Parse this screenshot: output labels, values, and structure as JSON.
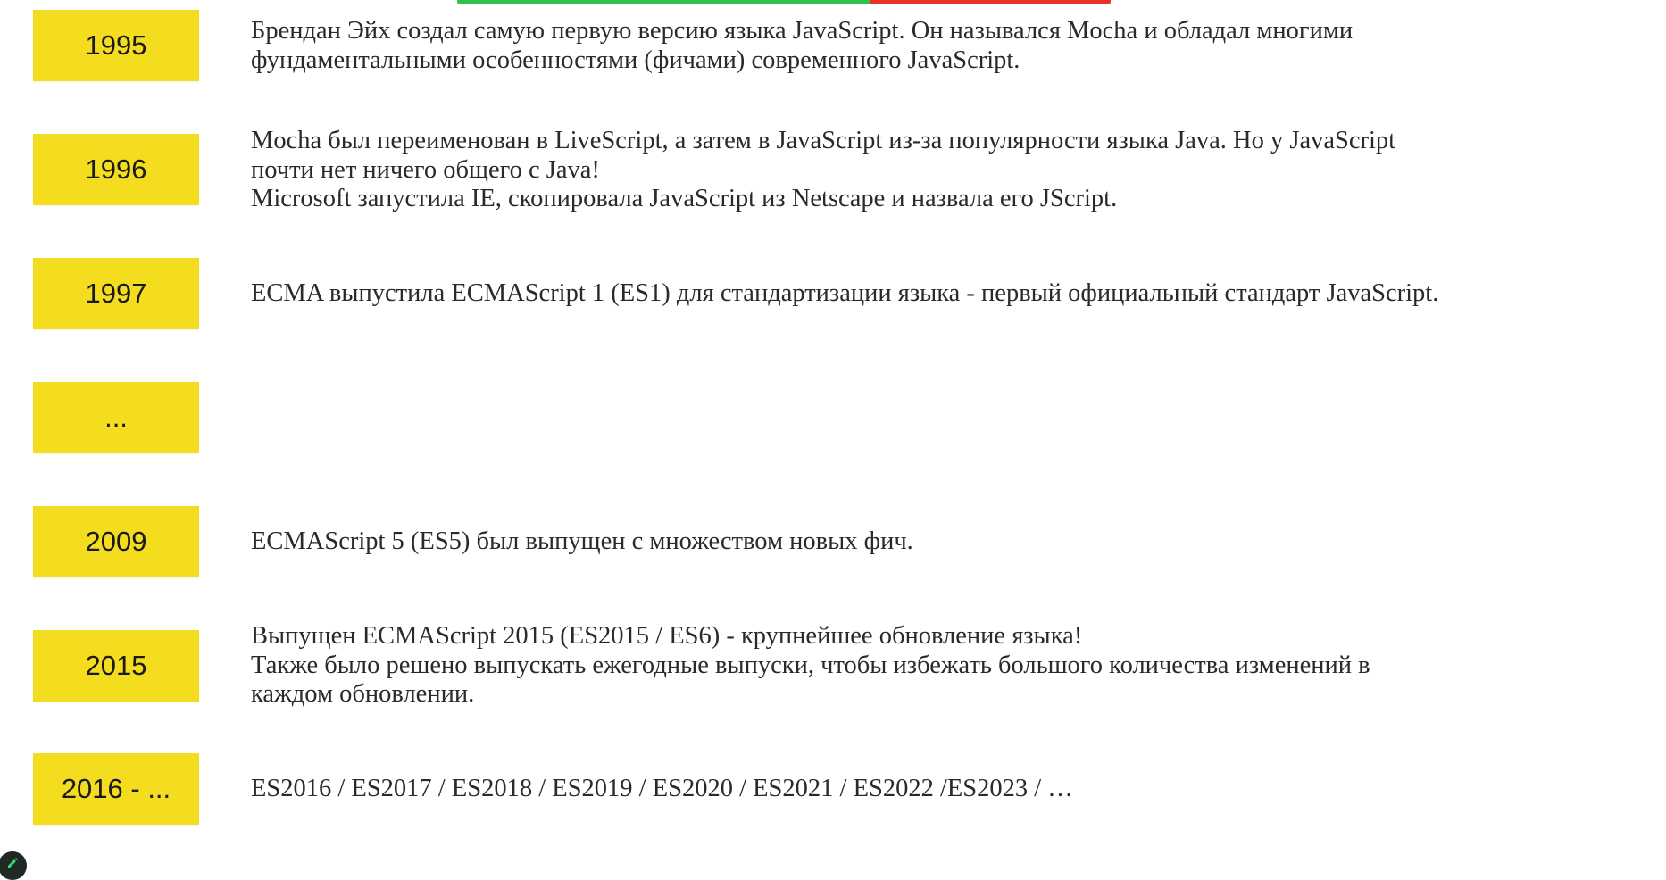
{
  "colors": {
    "year_box_bg": "#f4dc1e",
    "progress_green": "#2fbf4f",
    "progress_red": "#e8322a"
  },
  "timeline": [
    {
      "year": "1995",
      "lines": [
        "Брендан Эйх создал самую первую версию языка JavaScript. Он назывался Mocha и обладал многими",
        "фундаментальными особенностями (фичами) современного JavaScript."
      ]
    },
    {
      "year": "1996",
      "lines": [
        "Mocha был переименован в LiveScript, а затем в JavaScript из-за популярности языка Java. Но у JavaScript",
        "почти нет ничего общего с Java!",
        "Microsoft запустила IE, скопировала JavaScript из Netscape и назвала его JScript."
      ]
    },
    {
      "year": "1997",
      "lines": [
        "ECMA выпустила ECMAScript 1 (ES1) для стандартизации языка - первый официальный стандарт JavaScript."
      ]
    },
    {
      "year": "...",
      "lines": []
    },
    {
      "year": "2009",
      "lines": [
        "ECMAScript 5 (ES5) был выпущен с множеством новых фич."
      ]
    },
    {
      "year": "2015",
      "lines": [
        "Выпущен ECMAScript 2015 (ES2015 / ES6) - крупнейшее обновление языка!",
        "Также было решено выпускать ежегодные выпуски, чтобы избежать большого количества изменений в",
        "каждом обновлении."
      ]
    },
    {
      "year": "2016 - ...",
      "lines": [
        "ES2016 / ES2017 / ES2018 / ES2019 / ES2020 / ES2021 / ES2022 /ES2023 / …"
      ]
    }
  ],
  "icons": {
    "edit_fab": "pencil-icon"
  }
}
